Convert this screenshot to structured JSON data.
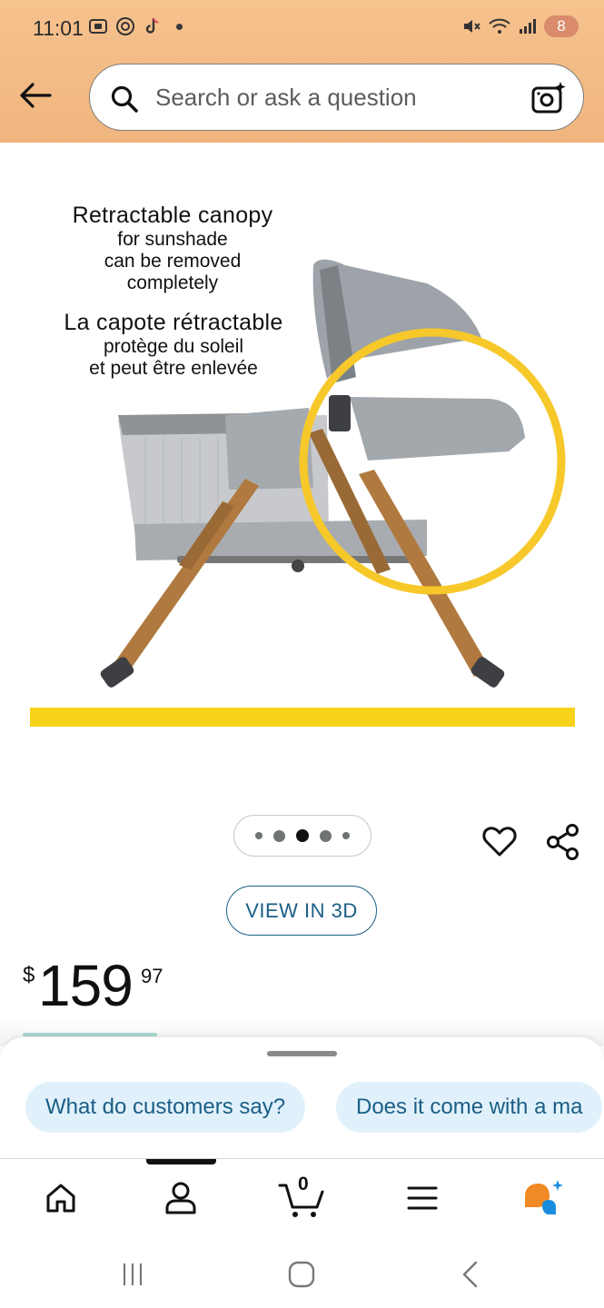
{
  "status_bar": {
    "time": "11:01",
    "battery": "8",
    "icons": [
      "screenshot-icon",
      "target-icon",
      "tiktok-icon",
      "mute-icon",
      "wifi-icon",
      "signal-icon"
    ]
  },
  "search": {
    "placeholder": "Search or ask a question"
  },
  "product_image": {
    "heading_en": "Retractable canopy",
    "sub_en_1": "for sunshade",
    "sub_en_2": "can be removed",
    "sub_en_3": "completely",
    "heading_fr": "La capote rétractable",
    "sub_fr_1": "protège du soleil",
    "sub_fr_2": "et peut être enlevée",
    "accent_yellow": "#f7d319"
  },
  "carousel": {
    "current_index": 3,
    "total": 5
  },
  "view_3d": {
    "label": "VIEW IN 3D"
  },
  "price": {
    "symbol": "$",
    "whole": "159",
    "fraction": "97"
  },
  "suggestions": [
    {
      "label": "What do customers say?"
    },
    {
      "label": "Does it come with a ma"
    }
  ],
  "bottom_nav": {
    "items": [
      "home-icon",
      "account-icon",
      "cart-icon",
      "menu-icon",
      "rufus-icon"
    ],
    "cart_count": "0",
    "active_index": 1
  },
  "system_nav": [
    "recents-icon",
    "home-circle-icon",
    "back-chevron-icon"
  ],
  "colors": {
    "header_bg": "#f0b57e",
    "link_blue": "#1a5e86",
    "chip_bg": "#e1f1fb"
  }
}
